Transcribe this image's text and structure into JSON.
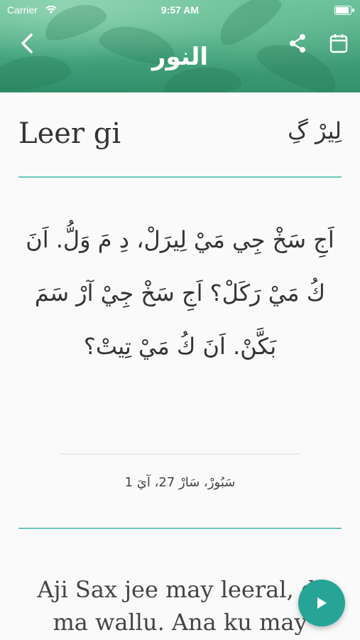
{
  "status_bar": {
    "carrier": "Carrier",
    "time": "9:57 AM",
    "battery_level_percent": 100
  },
  "header": {
    "title": "النور",
    "icons": {
      "back": "chevron-left-icon",
      "share": "share-icon",
      "calendar": "calendar-icon"
    }
  },
  "word": {
    "english": "Leer gi",
    "arabic": "لِيرْ گِ"
  },
  "verse": {
    "arabic": "اَجِ سَخْ جِي مَيْ لِيرَلْ، دِ مَ وَلُّ. اَنَ كُ مَيْ رَكَلْ؟ اَجِ سَخْ جِيْ آرْ سَمَ بَكَّنْ. اَنَ كُ مَيْ تِيتْ؟",
    "reference": "سَبُورْ، سَارْ 27، آيَ 1",
    "english_partial": "Aji Sax jee may leeral, di ma wallu. Ana ku may"
  },
  "colors": {
    "accent": "#6cc6bd",
    "fab": "#26a596",
    "header_green": "#45a57e"
  }
}
